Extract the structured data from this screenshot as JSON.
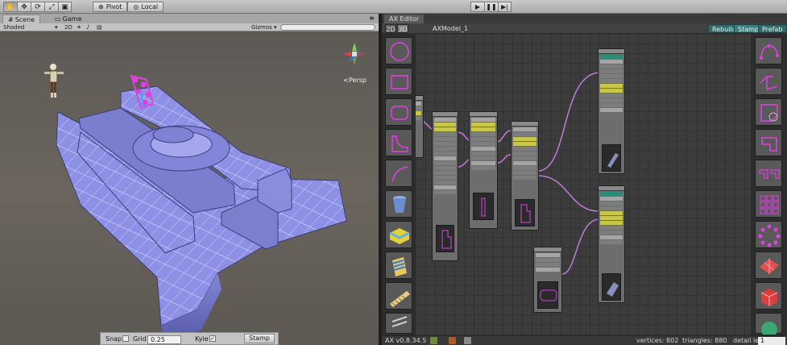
{
  "toolbar": {
    "tools": [
      "hand-tool",
      "move-tool",
      "rotate-tool",
      "scale-tool",
      "rect-tool"
    ],
    "pivot_label": "Pivot",
    "space_label": "Local"
  },
  "scene": {
    "tab_scene": "Scene",
    "tab_game": "Game",
    "shading": "Shaded",
    "mode_2d": "2D",
    "gizmos": "Gizmos",
    "persp": "Persp",
    "snap_label": "Snap",
    "grid_label": "Grid",
    "grid_value": "0.25",
    "kyle_label": "Kyle",
    "stamp_label": "Stamp"
  },
  "ax": {
    "tab_label": "AX Editor",
    "btn_2d": "2D",
    "btn_3d": "3D",
    "model_name": "AXModel_1",
    "rebuild": "Rebuild",
    "stamp": "Stamp",
    "prefab": "Prefab",
    "version": "AX v0.8.34.5",
    "vertices_label": "vertices: 802",
    "triangles_label": "triangles: 880",
    "detail_label": "detail level",
    "detail_value": "1"
  },
  "colors": {
    "accent_magenta": "#e040e0",
    "accent_teal": "#2e6b6b",
    "mesh_blue": "#8e90e6"
  }
}
